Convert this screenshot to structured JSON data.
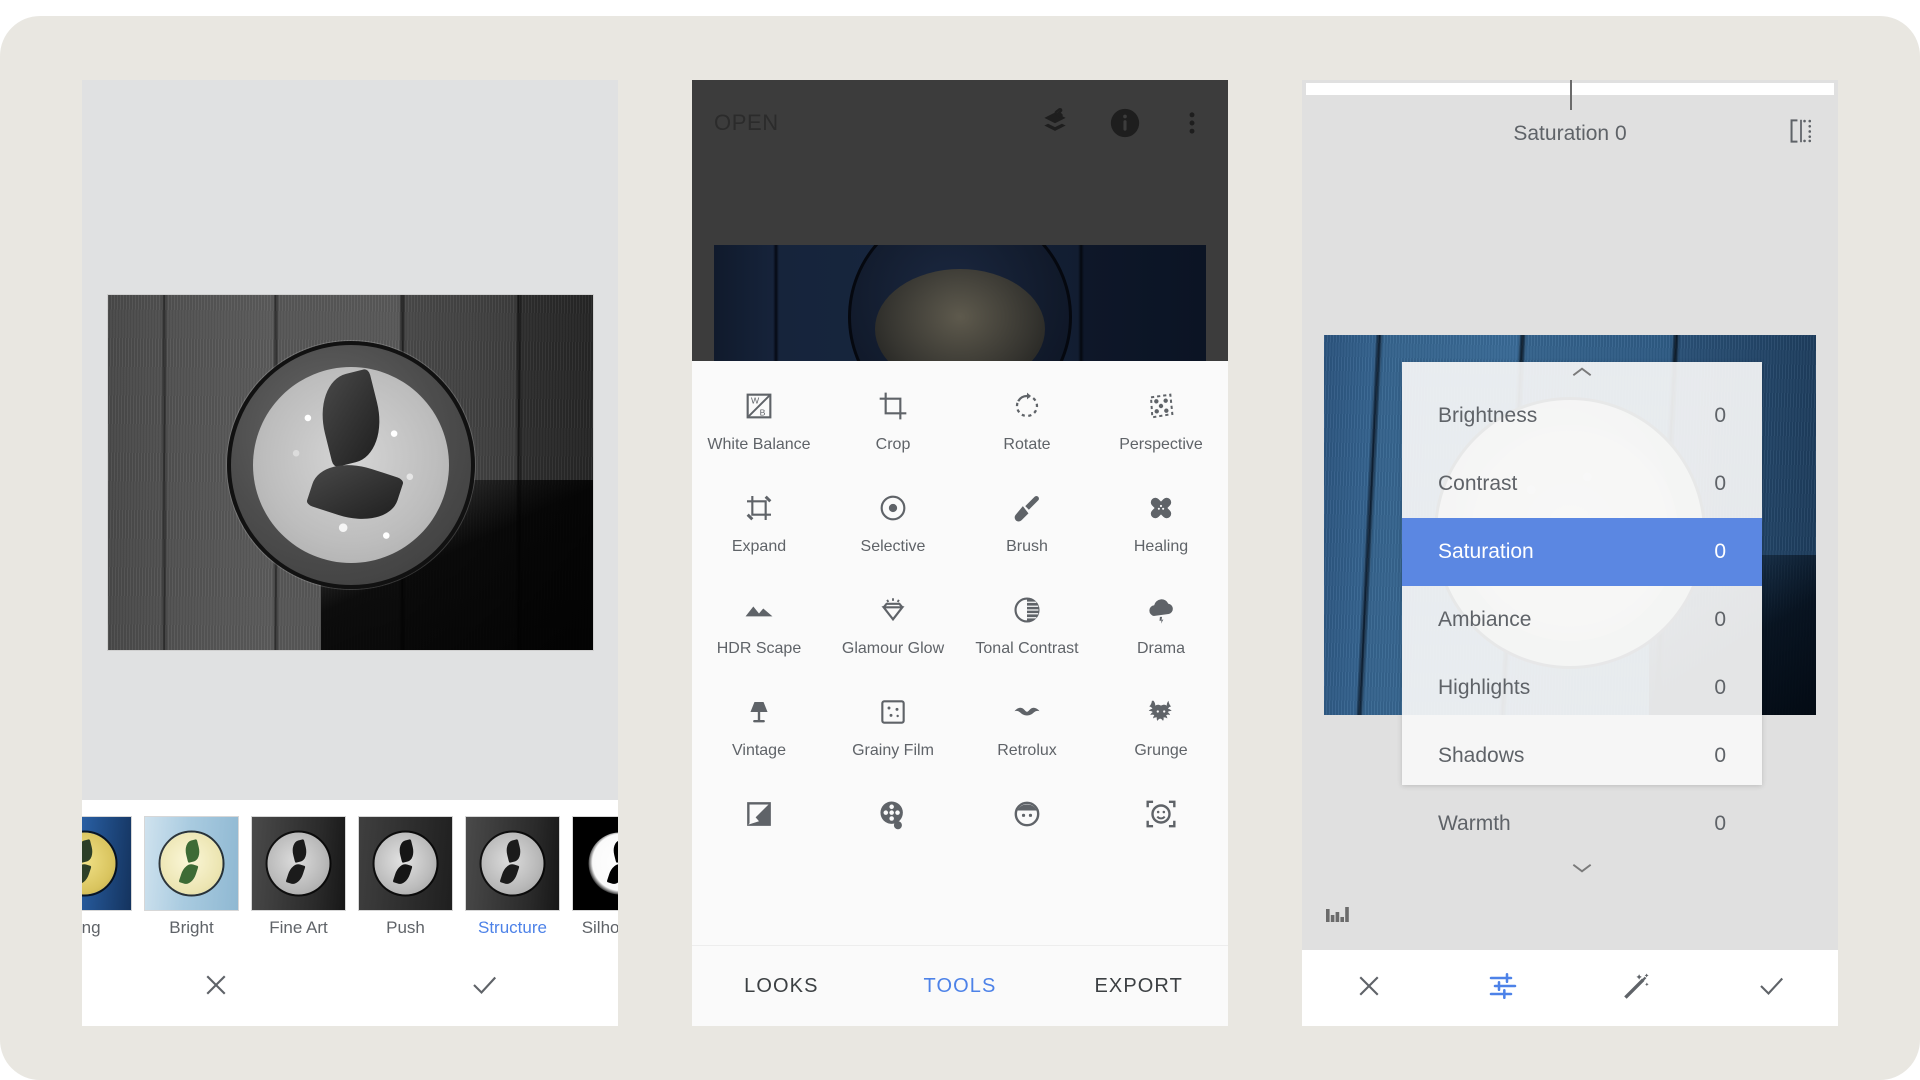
{
  "app": {
    "background_color": "#e9e7e1",
    "accent_color": "#4d82e8",
    "highlight_color": "#5b87e2"
  },
  "panel_looks": {
    "name": "Looks filter picker",
    "filmstrip": [
      {
        "label": "ning",
        "variant": "v-morning",
        "active": false
      },
      {
        "label": "Bright",
        "variant": "v-bright",
        "active": false
      },
      {
        "label": "Fine Art",
        "variant": "v-gray",
        "active": false
      },
      {
        "label": "Push",
        "variant": "v-gray2",
        "active": false
      },
      {
        "label": "Structure",
        "variant": "v-gray",
        "active": true
      },
      {
        "label": "Silhouette",
        "variant": "v-sil",
        "active": false
      }
    ],
    "actions": {
      "cancel": "close-icon",
      "accept": "check-icon"
    }
  },
  "panel_tools": {
    "topbar": {
      "open_label": "OPEN",
      "undo_icon": "undo-stack-icon",
      "info_icon": "info-icon",
      "overflow_icon": "more-vertical-icon"
    },
    "tools": [
      {
        "label": "White Balance",
        "icon": "white-balance-icon"
      },
      {
        "label": "Crop",
        "icon": "crop-icon"
      },
      {
        "label": "Rotate",
        "icon": "rotate-icon"
      },
      {
        "label": "Perspective",
        "icon": "perspective-icon"
      },
      {
        "label": "Expand",
        "icon": "expand-icon"
      },
      {
        "label": "Selective",
        "icon": "selective-icon"
      },
      {
        "label": "Brush",
        "icon": "brush-icon"
      },
      {
        "label": "Healing",
        "icon": "healing-icon"
      },
      {
        "label": "HDR Scape",
        "icon": "hdr-scape-icon"
      },
      {
        "label": "Glamour Glow",
        "icon": "glamour-glow-icon"
      },
      {
        "label": "Tonal Contrast",
        "icon": "tonal-contrast-icon"
      },
      {
        "label": "Drama",
        "icon": "drama-icon"
      },
      {
        "label": "Vintage",
        "icon": "vintage-icon"
      },
      {
        "label": "Grainy Film",
        "icon": "grainy-film-icon"
      },
      {
        "label": "Retrolux",
        "icon": "retrolux-icon"
      },
      {
        "label": "Grunge",
        "icon": "grunge-icon"
      },
      {
        "label": "",
        "icon": "double-exposure-icon"
      },
      {
        "label": "",
        "icon": "frames-icon"
      },
      {
        "label": "",
        "icon": "portrait-icon"
      },
      {
        "label": "",
        "icon": "head-pose-icon"
      }
    ],
    "tabs": [
      {
        "label": "LOOKS",
        "active": false
      },
      {
        "label": "TOOLS",
        "active": true
      },
      {
        "label": "EXPORT",
        "active": false
      }
    ]
  },
  "panel_tune": {
    "header": {
      "title": "Saturation 0",
      "compare_icon": "compare-split-icon"
    },
    "adjustments": [
      {
        "name": "Brightness",
        "value": "0",
        "selected": false
      },
      {
        "name": "Contrast",
        "value": "0",
        "selected": false
      },
      {
        "name": "Saturation",
        "value": "0",
        "selected": true
      },
      {
        "name": "Ambiance",
        "value": "0",
        "selected": false
      },
      {
        "name": "Highlights",
        "value": "0",
        "selected": false
      },
      {
        "name": "Shadows",
        "value": "0",
        "selected": false
      },
      {
        "name": "Warmth",
        "value": "0",
        "selected": false
      }
    ],
    "scroll_up_icon": "chevron-up-icon",
    "scroll_down_icon": "chevron-down-icon",
    "histogram_icon": "histogram-icon",
    "bottombar": [
      {
        "icon": "close-icon",
        "active": false
      },
      {
        "icon": "tune-icon",
        "active": true
      },
      {
        "icon": "magic-wand-icon",
        "active": false
      },
      {
        "icon": "check-icon",
        "active": false
      }
    ]
  }
}
